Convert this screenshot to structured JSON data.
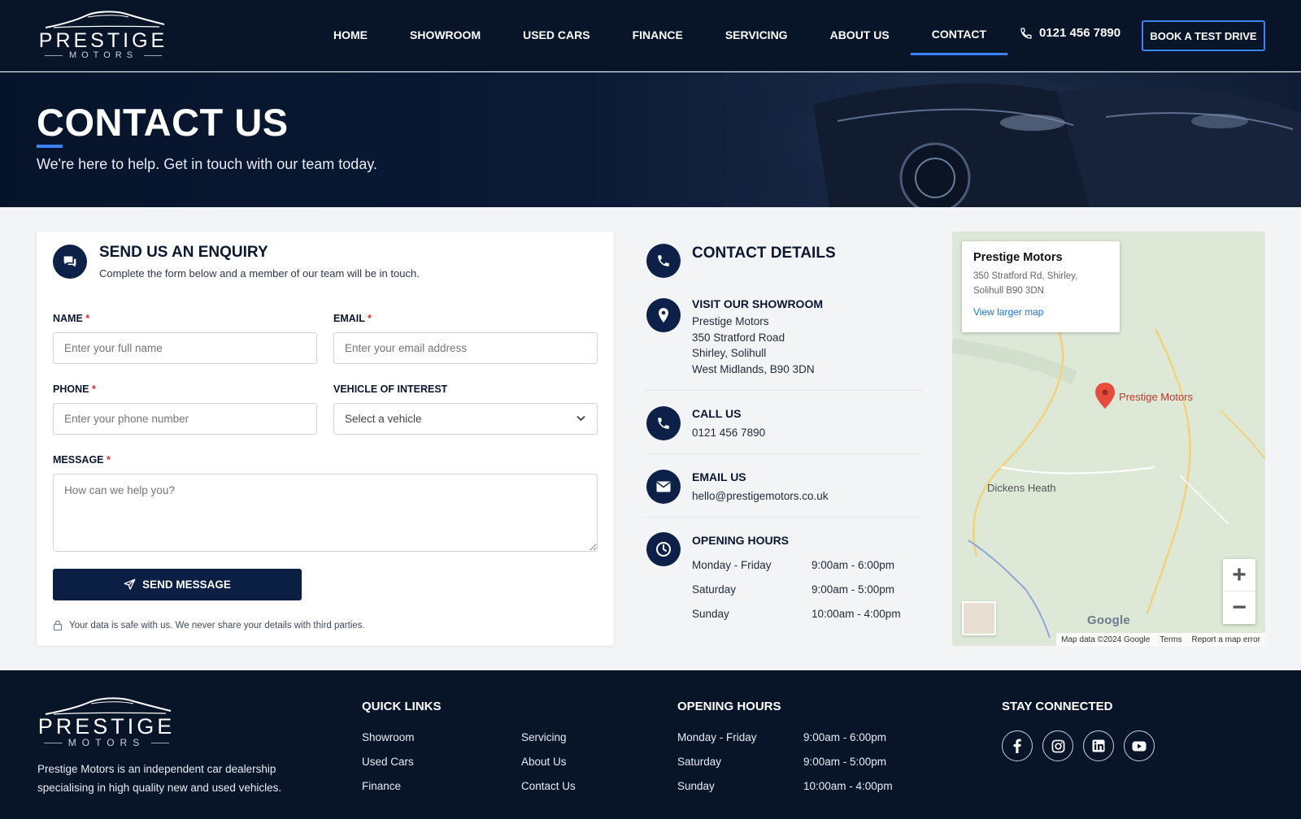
{
  "header": {
    "logo_word": "PRESTIGE",
    "logo_sub": "MOTORS",
    "nav": [
      "HOME",
      "SHOWROOM",
      "USED CARS",
      "FINANCE",
      "SERVICING",
      "ABOUT US",
      "CONTACT"
    ],
    "active_nav": "CONTACT",
    "phone": "0121 456 7890",
    "cta": "BOOK A TEST DRIVE"
  },
  "hero": {
    "title": "CONTACT US",
    "subtitle": "We're here to help. Get in touch with our team today."
  },
  "form": {
    "title": "SEND US AN ENQUIRY",
    "subtitle": "Complete the form below and a member of our team will be in touch.",
    "name_label": "NAME",
    "name_placeholder": "Enter your full name",
    "email_label": "EMAIL",
    "email_placeholder": "Enter your email address",
    "phone_label": "PHONE",
    "phone_placeholder": "Enter your phone number",
    "vehicle_label": "VEHICLE OF INTEREST",
    "vehicle_value": "Select a vehicle",
    "message_label": "MESSAGE",
    "message_placeholder": "How can we help you?",
    "required_mark": "*",
    "submit": "SEND MESSAGE",
    "privacy": "Your data is safe with us. We never share your details with third parties."
  },
  "details": {
    "title": "CONTACT DETAILS",
    "showroom_title": "VISIT OUR SHOWROOM",
    "showroom_lines": [
      "Prestige Motors",
      "350 Stratford Road",
      "Shirley, Solihull",
      "West Midlands, B90 3DN"
    ],
    "call_title": "CALL US",
    "call_value": "0121 456 7890",
    "email_title": "EMAIL US",
    "email_value": "hello@prestigemotors.co.uk",
    "hours_title": "OPENING HOURS",
    "hours": [
      {
        "day": "Monday - Friday",
        "time": "9:00am - 6:00pm"
      },
      {
        "day": "Saturday",
        "time": "9:00am - 5:00pm"
      },
      {
        "day": "Sunday",
        "time": "10:00am - 4:00pm"
      }
    ]
  },
  "map": {
    "info_title": "Prestige Motors",
    "info_address_1": "350 Stratford Rd, Shirley,",
    "info_address_2": "Solihull B90 3DN",
    "info_link": "View larger map",
    "pin_label": "Prestige Motors",
    "place_label": "Dickens Heath",
    "google": "Google",
    "footer_items": [
      "Map data ©2024 Google",
      "Terms",
      "Report a map error"
    ],
    "zoom_in": "+",
    "zoom_out": "−"
  },
  "footer": {
    "logo_word": "PRESTIGE",
    "logo_sub": "MOTORS",
    "description": "Prestige Motors is an independent car dealership specialising in high quality new and used vehicles.",
    "quick_links_title": "QUICK LINKS",
    "quick_links": [
      "Showroom",
      "Used Cars",
      "Finance",
      "Servicing",
      "About Us",
      "Contact Us"
    ],
    "hours_title": "OPENING HOURS",
    "hours": [
      {
        "day": "Monday - Friday",
        "time": "9:00am - 6:00pm"
      },
      {
        "day": "Saturday",
        "time": "9:00am - 5:00pm"
      },
      {
        "day": "Sunday",
        "time": "10:00am - 4:00pm"
      }
    ],
    "social_title": "STAY CONNECTED",
    "social_icons": [
      "facebook-icon",
      "instagram-icon",
      "linkedin-icon",
      "youtube-icon"
    ]
  },
  "colors": {
    "navy": "#081428",
    "accent": "#3b82f6",
    "button": "#0b1e44",
    "required": "#d12d2d",
    "map_pin": "#e74c3c"
  }
}
